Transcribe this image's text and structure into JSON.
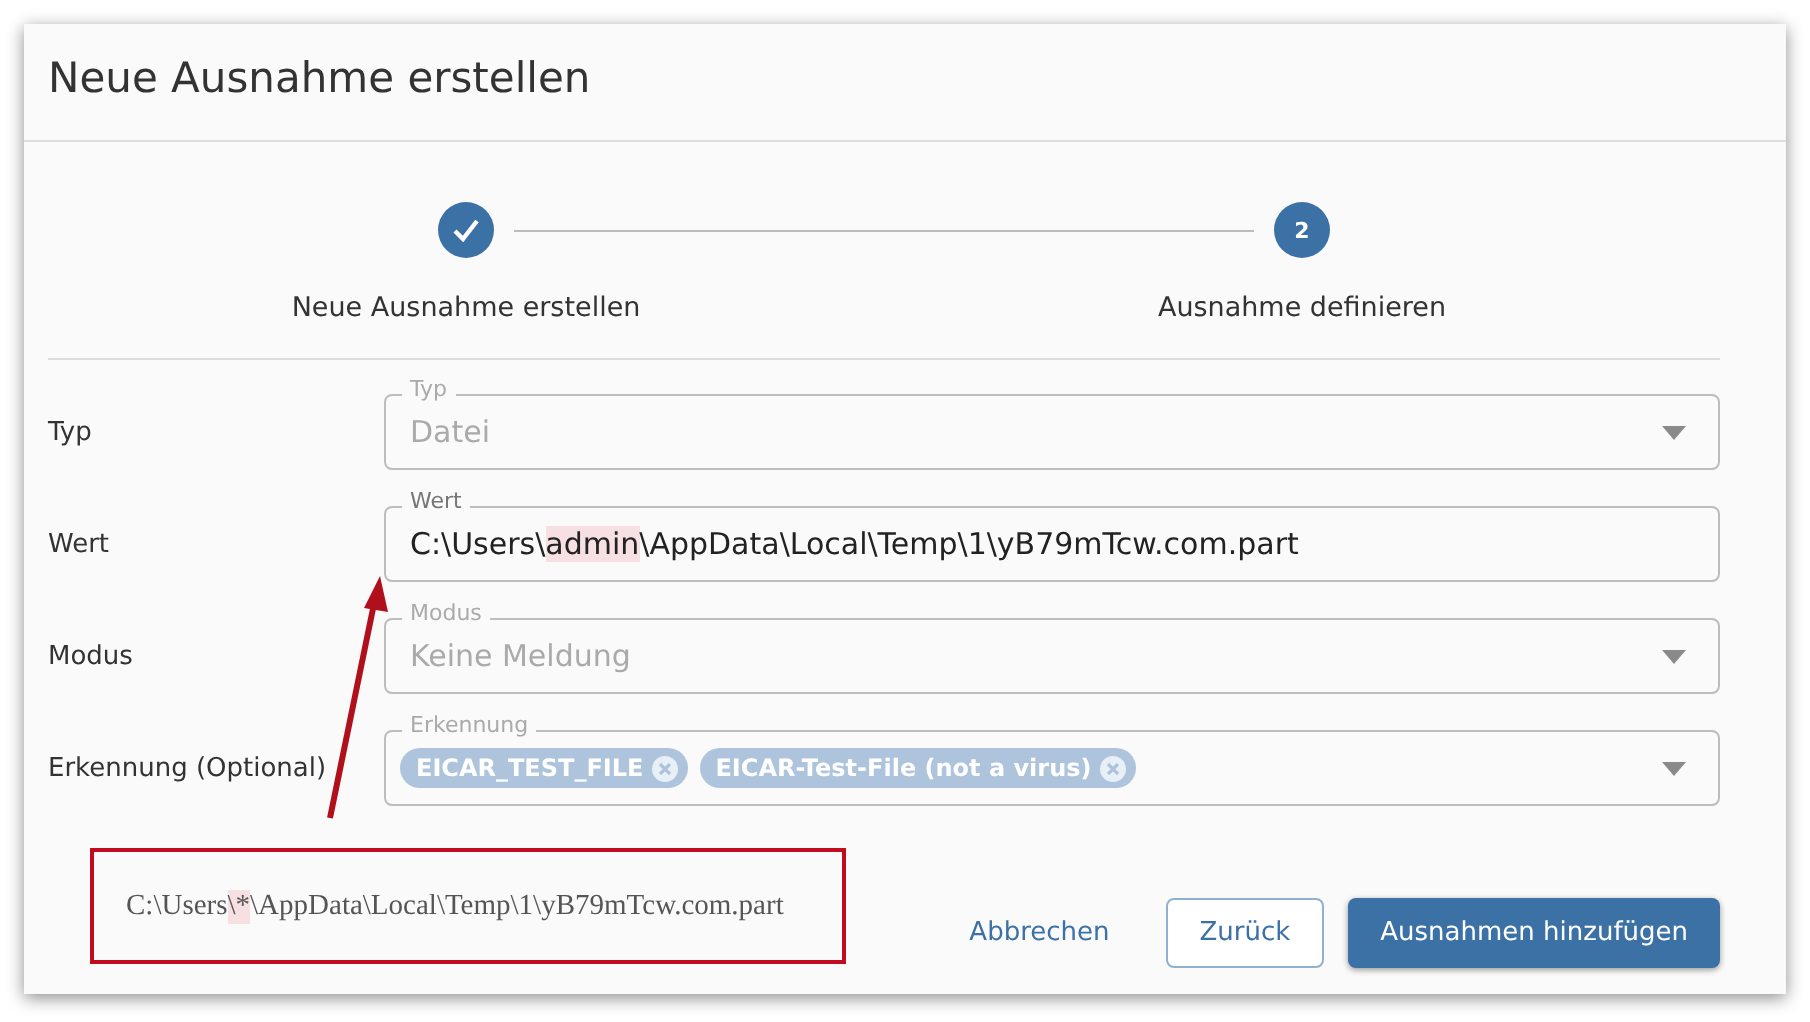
{
  "dialog": {
    "title": "Neue Ausnahme erstellen"
  },
  "steps": [
    {
      "label": "Neue Ausnahme erstellen",
      "done": true
    },
    {
      "label": "Ausnahme definieren",
      "marker": "2",
      "done": false
    }
  ],
  "fields": [
    {
      "label": "Typ",
      "kind": "select",
      "legend": "Typ",
      "value": [
        {
          "text": "Datei",
          "highlight": false
        }
      ],
      "disabled": true
    },
    {
      "label": "Wert",
      "kind": "text",
      "legend": "Wert",
      "value": [
        {
          "text": "C:\\Users\\",
          "highlight": false
        },
        {
          "text": "admin",
          "highlight": true
        },
        {
          "text": "\\AppData\\Local\\Temp\\1\\yB79mTcw.com.part",
          "highlight": false
        }
      ],
      "disabled": false
    },
    {
      "label": "Modus",
      "kind": "select",
      "legend": "Modus",
      "value": [
        {
          "text": "Keine Meldung",
          "highlight": false
        }
      ],
      "disabled": true
    },
    {
      "label": "Erkennung (Optional)",
      "kind": "chips",
      "legend": "Erkennung",
      "chips": [
        "EICAR_TEST_FILE",
        "EICAR-Test-File (not a virus)"
      ],
      "disabled": true
    }
  ],
  "annotation": {
    "text": [
      {
        "text": "C:\\Users",
        "highlight": false
      },
      {
        "text": "\\*",
        "highlight": true
      },
      {
        "text": "\\AppData\\Local\\Temp\\1\\yB79mTcw.com.part",
        "highlight": false
      }
    ]
  },
  "buttons": [
    {
      "label": "Abbrechen",
      "kind": "link"
    },
    {
      "label": "Zurück",
      "kind": "outline"
    },
    {
      "label": "Ausnahmen hinzufügen",
      "kind": "primary"
    }
  ]
}
